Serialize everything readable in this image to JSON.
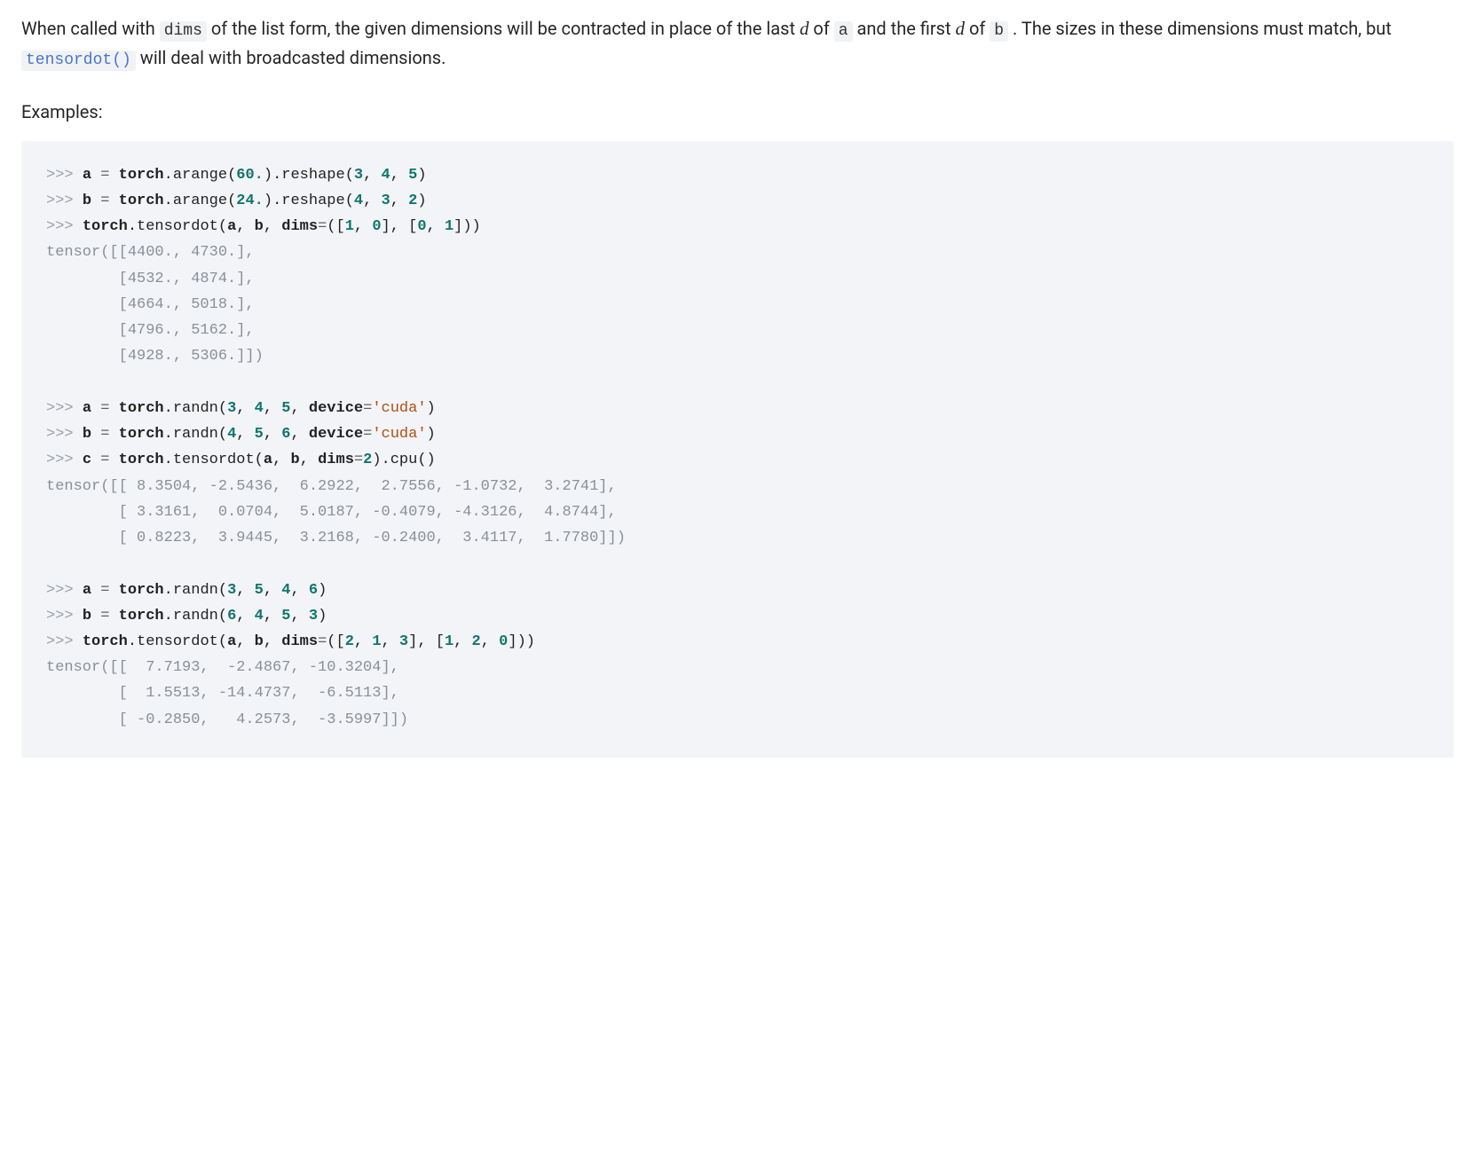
{
  "desc": {
    "pre": "When called with ",
    "dims": "dims",
    "mid1": " of the list form, the given dimensions will be contracted in place of the last ",
    "d1": "d",
    "mid2": " of ",
    "a": "a",
    "mid3": " and the first ",
    "d2": "d",
    "mid4": " of ",
    "b": "b",
    "mid5": " . The sizes in these dimensions must match, but ",
    "tensordot": "tensordot()",
    "tail": " will deal with broadcasted dimensions."
  },
  "examples_label": "Examples:",
  "code": {
    "p": ">>> ",
    "a_eq": "a ",
    "b_eq": "b ",
    "c_eq": "c ",
    "eq": "= ",
    "torch": "torch",
    "dot": ".",
    "arange": "arange",
    "reshape": "reshape",
    "tensordot": "tensordot",
    "randn": "randn",
    "cpu": "cpu",
    "lp": "(",
    "rp": ")",
    "comma": ", ",
    "dims_kw": "dims",
    "device_kw": "device",
    "cuda": "'cuda'",
    "lb": "[",
    "rb": "]",
    "n60": "60.",
    "n24": "24.",
    "n3": "3",
    "n4": "4",
    "n5": "5",
    "n2": "2",
    "n6": "6",
    "n1": "1",
    "n0": "0",
    "out1_l1": "tensor([[4400., 4730.],",
    "out1_l2": "        [4532., 4874.],",
    "out1_l3": "        [4664., 5018.],",
    "out1_l4": "        [4796., 5162.],",
    "out1_l5": "        [4928., 5306.]])",
    "out2_l1": "tensor([[ 8.3504, -2.5436,  6.2922,  2.7556, -1.0732,  3.2741],",
    "out2_l2": "        [ 3.3161,  0.0704,  5.0187, -0.4079, -4.3126,  4.8744],",
    "out2_l3": "        [ 0.8223,  3.9445,  3.2168, -0.2400,  3.4117,  1.7780]])",
    "out3_l1": "tensor([[  7.7193,  -2.4867, -10.3204],",
    "out3_l2": "        [  1.5513, -14.4737,  -6.5113],",
    "out3_l3": "        [ -0.2850,   4.2573,  -3.5997]])"
  }
}
